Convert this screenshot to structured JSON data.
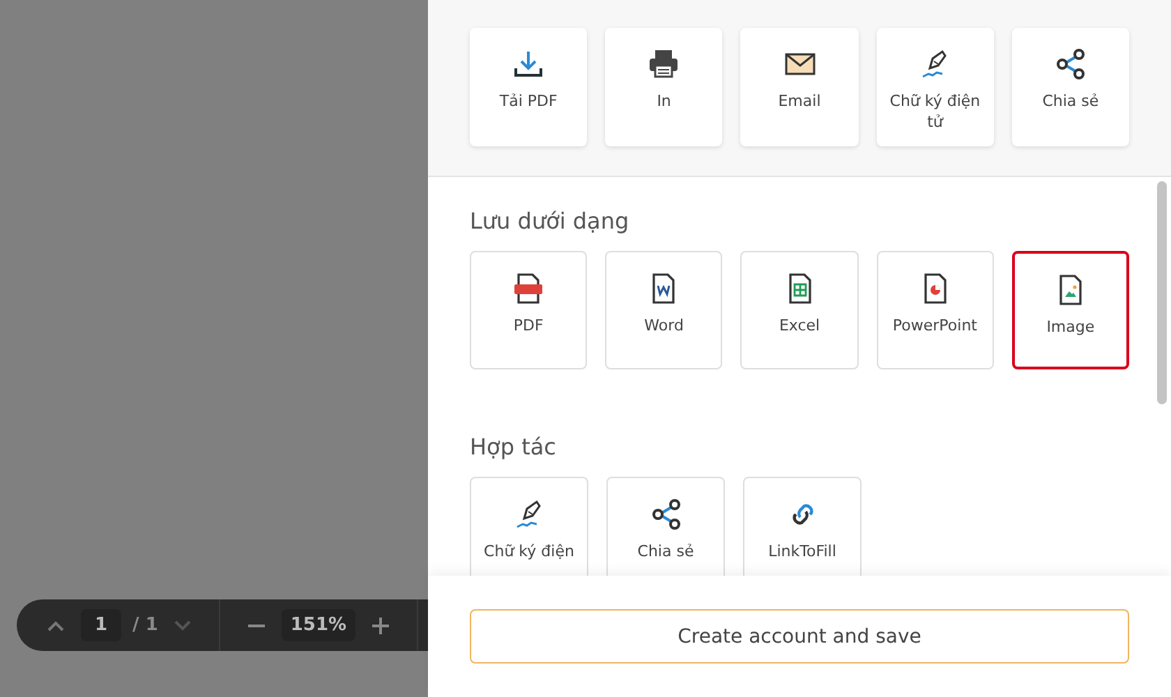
{
  "viewer_toolbar": {
    "page_input": "1",
    "page_total": "/ 1",
    "zoom": "151%"
  },
  "sections": [
    {
      "kind": "quick",
      "items": [
        {
          "label": "Tải PDF",
          "kind": "download",
          "selected": false
        },
        {
          "label": "In",
          "kind": "print",
          "selected": false
        },
        {
          "label": "Email",
          "kind": "email",
          "selected": false
        },
        {
          "label": "Chữ ký điện tử",
          "kind": "signature",
          "selected": false
        },
        {
          "label": "Chia sẻ",
          "kind": "share",
          "selected": false
        }
      ]
    },
    {
      "kind": "list",
      "heading": "Lưu dưới dạng",
      "items": [
        {
          "label": "PDF",
          "kind": "pdf",
          "selected": false
        },
        {
          "label": "Word",
          "kind": "word",
          "selected": false
        },
        {
          "label": "Excel",
          "kind": "excel",
          "selected": false
        },
        {
          "label": "PowerPoint",
          "kind": "powerpoint",
          "selected": false
        },
        {
          "label": "Image",
          "kind": "image",
          "selected": true
        }
      ]
    },
    {
      "kind": "list",
      "heading": "Hợp tác",
      "items": [
        {
          "label": "Chữ ký điện",
          "kind": "signature",
          "selected": false
        },
        {
          "label": "Chia sẻ",
          "kind": "share",
          "selected": false
        },
        {
          "label": "LinkToFill",
          "kind": "link",
          "selected": false
        }
      ]
    }
  ],
  "footer_button": "Create account and save"
}
